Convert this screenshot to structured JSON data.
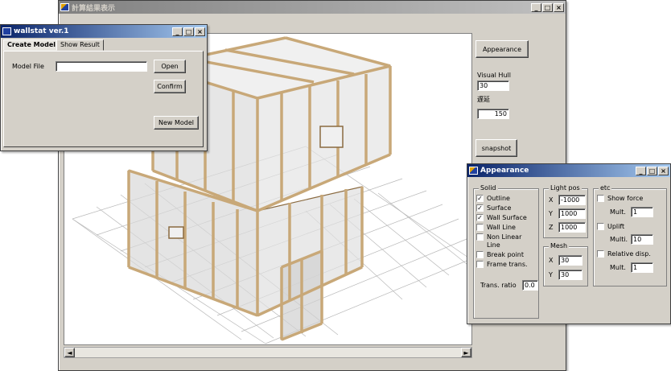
{
  "main_window": {
    "title": "計算結果表示",
    "buttons": {
      "appearance": "Appearance",
      "snapshot": "snapshot"
    },
    "visual_hull_label": "Visual Hull",
    "visual_hull_value": "30",
    "delay_label": "遅延",
    "delay_value": "150",
    "scrollbar_left": "◄",
    "scrollbar_right": "►"
  },
  "wallstat_window": {
    "title": "wallstat ver.1",
    "tabs": [
      "Create Model",
      "Show Result"
    ],
    "model_file_label": "Model File",
    "model_file_value": "",
    "open_label": "Open",
    "confirm_label": "Confirm",
    "new_model_label": "New Model"
  },
  "appearance_window": {
    "title": "Appearance",
    "solid": {
      "title": "Solid",
      "items": [
        {
          "label": "Outline",
          "checked": true
        },
        {
          "label": "Surface",
          "checked": true
        },
        {
          "label": "Wall Surface",
          "checked": true
        },
        {
          "label": "Wall Line",
          "checked": false
        },
        {
          "label": "Non Linear",
          "checked": false
        },
        {
          "label": "Line",
          "checked": false
        },
        {
          "label": "Break point",
          "checked": false
        },
        {
          "label": "Frame trans.",
          "checked": false
        }
      ],
      "trans_ratio_label": "Trans. ratio",
      "trans_ratio_value": "0.0"
    },
    "light_pos": {
      "title": "Light pos",
      "x_label": "X",
      "x_value": "-1000",
      "y_label": "Y",
      "y_value": "1000",
      "z_label": "Z",
      "z_value": "1000"
    },
    "mesh": {
      "title": "Mesh",
      "x_label": "X",
      "x_value": "30",
      "y_label": "Y",
      "y_value": "30"
    },
    "etc": {
      "title": "etc",
      "show_force": "Show force",
      "show_force_mult_label": "Mult.",
      "show_force_mult": "1",
      "uplift": "Uplift",
      "uplift_mult_label": "Multi.",
      "uplift_mult": "10",
      "relative_disp": "Relative disp.",
      "relative_disp_mult_label": "Mult.",
      "relative_disp_mult": "1"
    }
  },
  "title_buttons": {
    "min": "_",
    "max": "□",
    "close": "×"
  },
  "colors": {
    "titlebar_active": "#0a246a",
    "frame_wood": "#c8a878",
    "panel_glass": "#dcdcdc"
  }
}
